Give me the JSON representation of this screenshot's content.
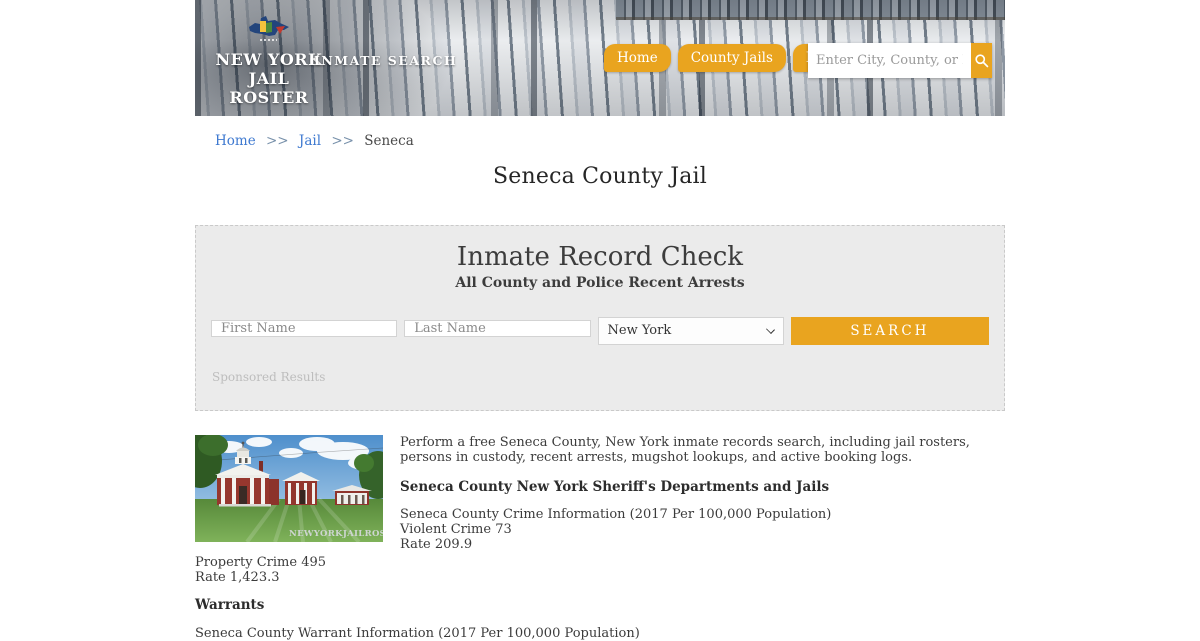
{
  "colors": {
    "accent_orange": "#E9A41F",
    "link_blue": "#3E79D0",
    "box_gray": "#EBEBEB"
  },
  "header": {
    "logo": {
      "line1": "NEW YORK",
      "line2": "JAIL ROSTER"
    },
    "tagline": "INMATE SEARCH",
    "nav": [
      {
        "label": "Home"
      },
      {
        "label": "County Jails"
      },
      {
        "label": "Police"
      }
    ],
    "search": {
      "placeholder": "Enter City, County, or Facility",
      "icon": "search-icon"
    }
  },
  "breadcrumb": {
    "separator": ">>",
    "items": [
      {
        "label": "Home",
        "link": true
      },
      {
        "label": "Jail",
        "link": true
      },
      {
        "label": "Seneca",
        "link": false
      }
    ]
  },
  "page_title": "Seneca County Jail",
  "record_check": {
    "title": "Inmate Record Check",
    "subtitle": "All County and Police Recent Arrests",
    "first_name_placeholder": "First Name",
    "last_name_placeholder": "Last Name",
    "state_selected": "New York",
    "search_button": "SEARCH",
    "sponsored": "Sponsored Results"
  },
  "content": {
    "image_watermark": "NEWYORKJAILROSTER.COM",
    "intro": "Perform a free Seneca County, New York inmate records search, including jail rosters, persons in custody, recent arrests, mugshot lookups, and active booking logs.",
    "dept_heading": "Seneca County New York Sheriff's Departments and Jails",
    "crime_lines": [
      "Seneca County Crime Information (2017 Per 100,000 Population)",
      "Violent Crime 73",
      "Rate 209.9",
      "Property Crime 495",
      "Rate 1,423.3"
    ],
    "warrants_heading": "Warrants",
    "clipped_line": "Seneca County Warrant Information (2017 Per 100,000 Population)"
  }
}
